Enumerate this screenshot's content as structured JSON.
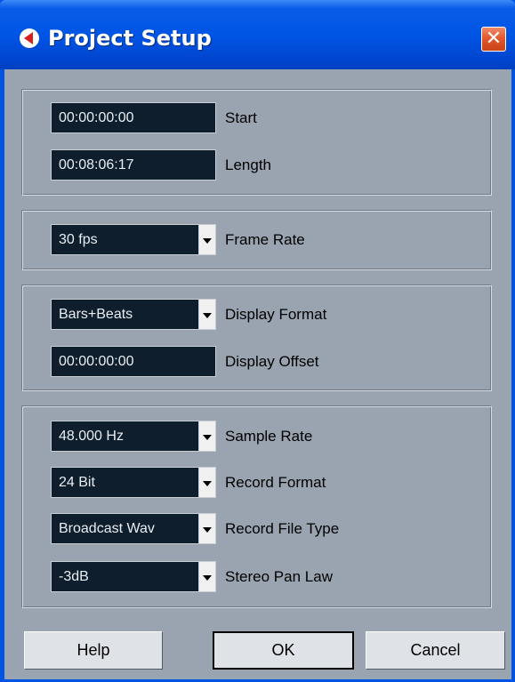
{
  "window": {
    "title": "Project Setup",
    "close_glyph": "✕",
    "app_icon": "cubase-icon",
    "titlebar_color": "#0055e5",
    "client_color": "#9aa4b0",
    "field_color": "#0e1e2c"
  },
  "time": {
    "start_value": "00:00:00:00",
    "start_label": "Start",
    "length_value": "00:08:06:17",
    "length_label": "Length"
  },
  "frame": {
    "frame_rate_value": "30 fps",
    "frame_rate_label": "Frame Rate"
  },
  "display": {
    "format_value": "Bars+Beats",
    "format_label": "Display Format",
    "offset_value": "00:00:00:00",
    "offset_label": "Display Offset"
  },
  "audio": {
    "sample_rate_value": "48.000 Hz",
    "sample_rate_label": "Sample Rate",
    "record_format_value": "24 Bit",
    "record_format_label": "Record Format",
    "file_type_value": "Broadcast Wav",
    "file_type_label": "Record File Type",
    "pan_law_value": "-3dB",
    "pan_law_label": "Stereo Pan Law"
  },
  "buttons": {
    "help": "Help",
    "ok": "OK",
    "cancel": "Cancel"
  }
}
